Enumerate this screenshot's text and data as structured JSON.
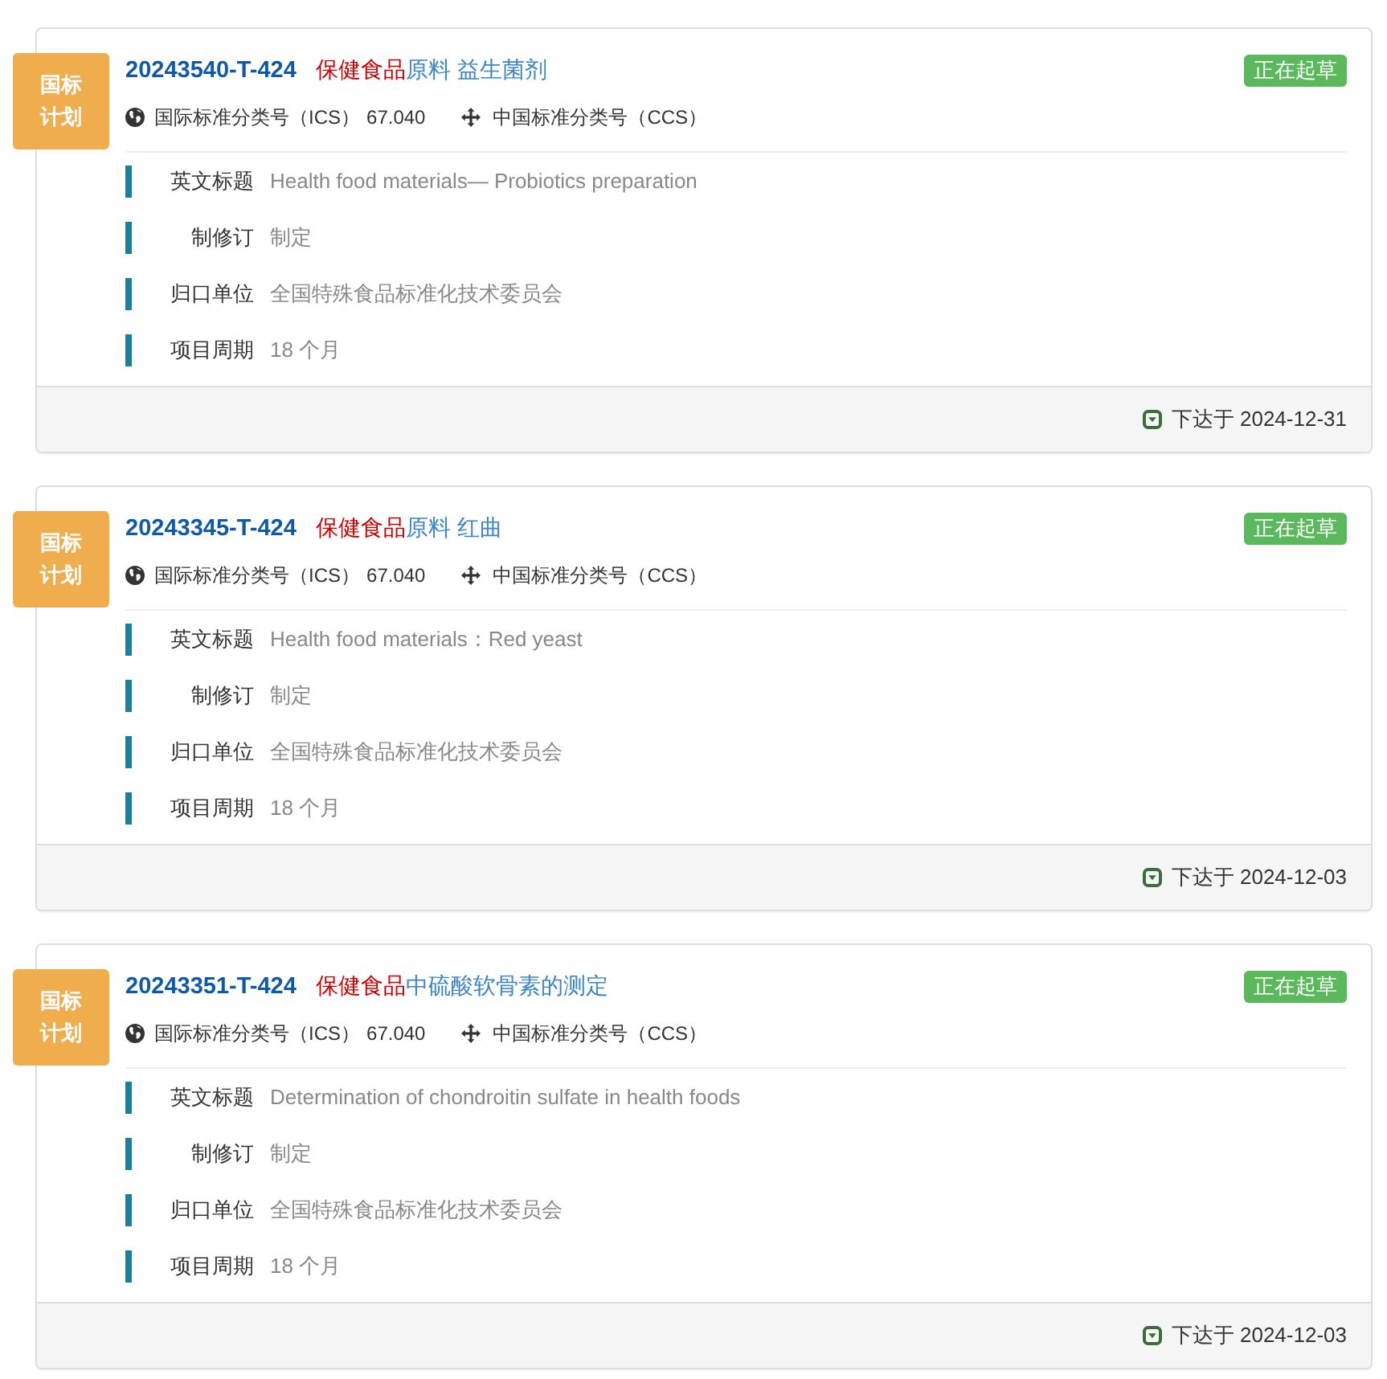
{
  "items": [
    {
      "badge": "国标计划",
      "code": "20243540-T-424",
      "title": [
        {
          "text": "保健食品",
          "highlighted": true
        },
        {
          "text": "原料 益生菌剂",
          "highlighted": false
        }
      ],
      "status": "正在起草",
      "ics_label": "国际标准分类号（ICS）",
      "ics_value": "67.040",
      "ccs_label": "中国标准分类号（CCS）",
      "fields": [
        {
          "label": "英文标题",
          "value": "Health food materials— Probiotics preparation"
        },
        {
          "label": "制修订",
          "value": "制定"
        },
        {
          "label": "归口单位",
          "value": "全国特殊食品标准化技术委员会"
        },
        {
          "label": "项目周期",
          "value": "18 个月"
        }
      ],
      "issued": "下达于 2024-12-31"
    },
    {
      "badge": "国标计划",
      "code": "20243345-T-424",
      "title": [
        {
          "text": "保健食品",
          "highlighted": true
        },
        {
          "text": "原料 红曲",
          "highlighted": false
        }
      ],
      "status": "正在起草",
      "ics_label": "国际标准分类号（ICS）",
      "ics_value": "67.040",
      "ccs_label": "中国标准分类号（CCS）",
      "fields": [
        {
          "label": "英文标题",
          "value": "Health food materials：Red yeast"
        },
        {
          "label": "制修订",
          "value": "制定"
        },
        {
          "label": "归口单位",
          "value": "全国特殊食品标准化技术委员会"
        },
        {
          "label": "项目周期",
          "value": "18 个月"
        }
      ],
      "issued": "下达于 2024-12-03"
    },
    {
      "badge": "国标计划",
      "code": "20243351-T-424",
      "title": [
        {
          "text": "保健食品",
          "highlighted": true
        },
        {
          "text": "中硫酸软骨素的测定",
          "highlighted": false
        }
      ],
      "status": "正在起草",
      "ics_label": "国际标准分类号（ICS）",
      "ics_value": "67.040",
      "ccs_label": "中国标准分类号（CCS）",
      "fields": [
        {
          "label": "英文标题",
          "value": "Determination of chondroitin sulfate in health foods"
        },
        {
          "label": "制修订",
          "value": "制定"
        },
        {
          "label": "归口单位",
          "value": "全国特殊食品标准化技术委员会"
        },
        {
          "label": "项目周期",
          "value": "18 个月"
        }
      ],
      "issued": "下达于 2024-12-03"
    }
  ]
}
